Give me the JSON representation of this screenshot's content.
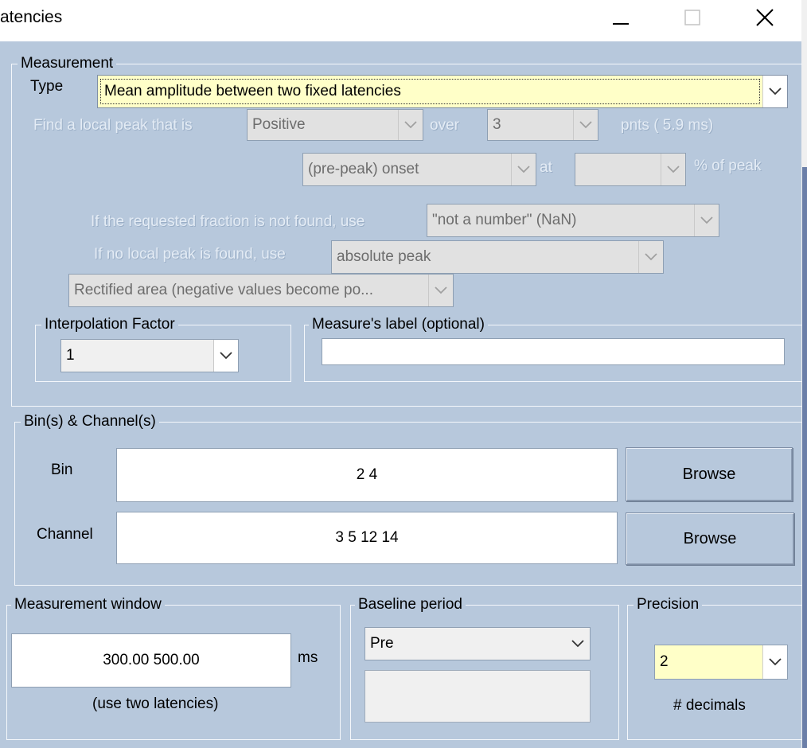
{
  "window": {
    "title": "atencies"
  },
  "measurement": {
    "legend": "Measurement",
    "type_label": "Type",
    "type_value": "Mean amplitude between two fixed latencies",
    "find_peak_label": "Find a local peak that is",
    "polarity_value": "Positive",
    "over_label": "over",
    "points_value": "3",
    "points_unit": "pnts ( 5.9 ms)",
    "onset_value": "(pre-peak) onset",
    "at_label": "at",
    "percent_value": "",
    "percent_label": "% of peak",
    "fraction_label": "If the requested fraction is not found, use",
    "fraction_value": "\"not a number\" (NaN)",
    "nopeak_label": "If no local peak is found, use",
    "nopeak_value": "absolute peak",
    "rectified_value": "Rectified area (negative values become po..."
  },
  "interpolation": {
    "legend": "Interpolation Factor",
    "value": "1"
  },
  "measure_label": {
    "legend": "Measure's label (optional)",
    "value": ""
  },
  "bins_channels": {
    "legend": "Bin(s) & Channel(s)",
    "bin_label": "Bin",
    "bin_value": "2 4",
    "channel_label": "Channel",
    "channel_value": "3 5 12 14",
    "browse_label": "Browse"
  },
  "window_group": {
    "legend": "Measurement window",
    "value": "300.00  500.00",
    "unit": "ms",
    "hint": "(use two latencies)"
  },
  "baseline": {
    "legend": "Baseline period",
    "value": "Pre",
    "custom_value": ""
  },
  "precision": {
    "legend": "Precision",
    "value": "2",
    "hint": "# decimals"
  },
  "colors": {
    "background": "#b7c8dc",
    "highlight_field": "#ffffc8"
  }
}
